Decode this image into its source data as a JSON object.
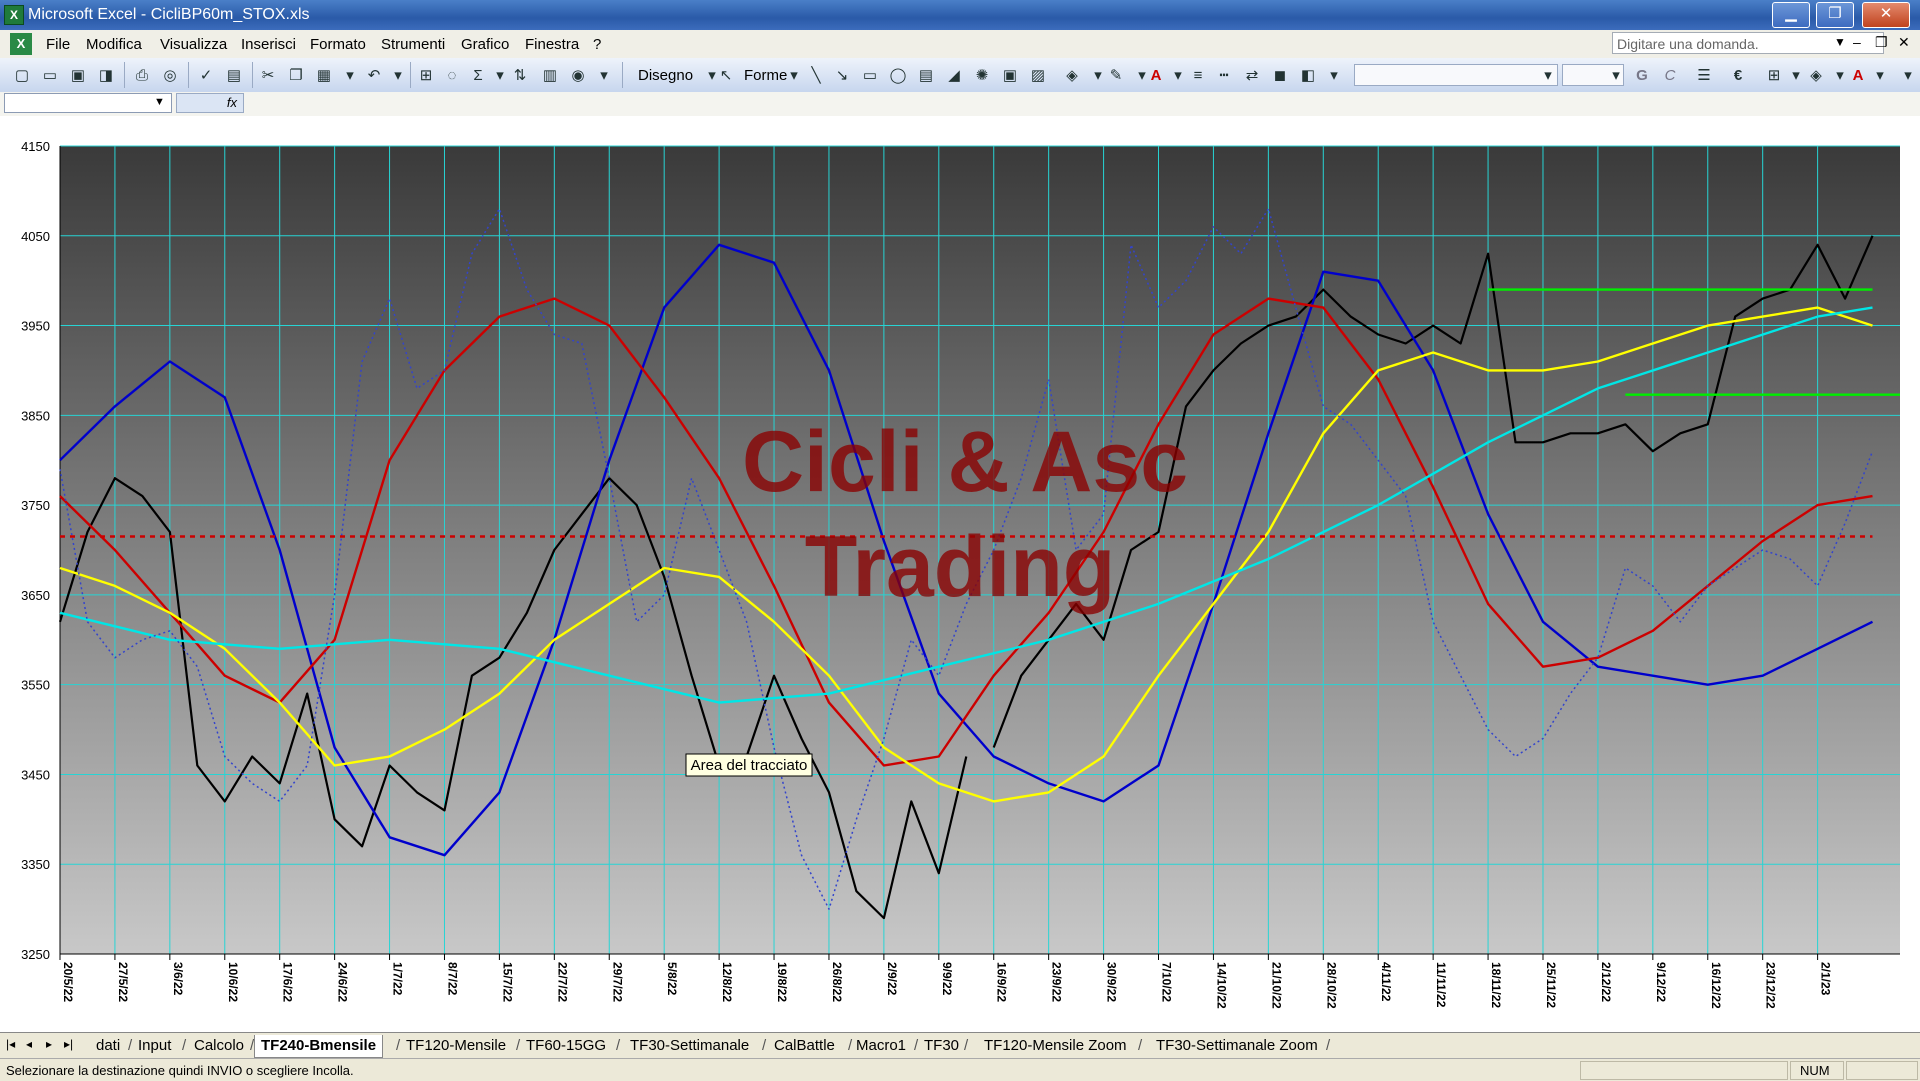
{
  "window": {
    "title": "Microsoft Excel - CicliBP60m_STOX.xls",
    "minimize": "▁",
    "restore": "❐",
    "close": "✕"
  },
  "menu": {
    "items": [
      "File",
      "Modifica",
      "Visualizza",
      "Inserisci",
      "Formato",
      "Strumenti",
      "Grafico",
      "Finestra",
      "?"
    ],
    "help_placeholder": "Digitare una domanda.",
    "doc_minimize": "‒",
    "doc_restore": "❐",
    "doc_close": "✕"
  },
  "toolbar": {
    "draw_label": "Disegno",
    "shapes_label": "Forme",
    "bold": "G",
    "italic": "C",
    "euro": "€"
  },
  "formula_bar": {
    "fx": "fx"
  },
  "chart_data": {
    "type": "line",
    "x_tick_labels": [
      "20/5/22",
      "27/5/22",
      "3/6/22",
      "10/6/22",
      "17/6/22",
      "24/6/22",
      "1/7/22",
      "8/7/22",
      "15/7/22",
      "22/7/22",
      "29/7/22",
      "5/8/22",
      "12/8/22",
      "19/8/22",
      "26/8/22",
      "2/9/22",
      "9/9/22",
      "16/9/22",
      "23/9/22",
      "30/9/22",
      "7/10/22",
      "14/10/22",
      "21/10/22",
      "28/10/22",
      "4/11/22",
      "11/11/22",
      "18/11/22",
      "25/11/22",
      "2/12/22",
      "9/12/22",
      "16/12/22",
      "23/12/22",
      "2/1/23"
    ],
    "y_ticks": [
      3250,
      3350,
      3450,
      3550,
      3650,
      3750,
      3850,
      3950,
      4050,
      4150
    ],
    "ylim": [
      3250,
      4150
    ],
    "grid": true,
    "legend": "none",
    "watermark": [
      "Cicli & Asc",
      "Trading"
    ],
    "tooltip": "Area del tracciato",
    "background": {
      "top": "#3a3a3a",
      "bottom": "#c8c8c8"
    },
    "series": [
      {
        "color": "#000000",
        "style": "solid",
        "x": [
          0,
          1,
          2,
          3,
          4,
          5,
          6,
          7,
          8,
          9,
          10,
          11,
          12,
          13,
          14,
          15,
          16,
          17,
          18,
          19,
          20,
          21,
          22,
          23,
          24,
          25,
          26,
          27,
          28,
          29,
          30,
          31,
          32,
          33
        ],
        "values": [
          3620,
          3720,
          3780,
          3760,
          3720,
          3460,
          3420,
          3470,
          3440,
          3540,
          3400,
          3370,
          3460,
          3430,
          3410,
          3560,
          3580,
          3630,
          3700,
          3740,
          3780,
          3750,
          3670,
          3560,
          3460,
          3470,
          3560,
          3490,
          3430,
          3320,
          3290,
          3420,
          3340,
          3470
        ]
      },
      {
        "color": "#000000",
        "style": "solid",
        "x": [
          34,
          35,
          36,
          37,
          38,
          39,
          40,
          41,
          42,
          43,
          44,
          45,
          46,
          47,
          48,
          49,
          50,
          51,
          52,
          53,
          54,
          55,
          56,
          57,
          58,
          59,
          60,
          61,
          62,
          63,
          64,
          65,
          66
        ],
        "values": [
          3480,
          3560,
          3600,
          3640,
          3600,
          3700,
          3720,
          3860,
          3900,
          3930,
          3950,
          3960,
          3990,
          3960,
          3940,
          3930,
          3950,
          3930,
          4030,
          3820,
          3820,
          3830,
          3830,
          3840,
          3810,
          3830,
          3840,
          3960,
          3980,
          3990,
          4040,
          3980,
          4050
        ]
      },
      {
        "color": "#0000cc",
        "style": "solid",
        "x": [
          0,
          2,
          4,
          6,
          8,
          10,
          12,
          14,
          16,
          18,
          20,
          22,
          24,
          26,
          28,
          30,
          32,
          34,
          36,
          38,
          40,
          42,
          44,
          46,
          48,
          50,
          52,
          54,
          56,
          58,
          60,
          62,
          64,
          66
        ],
        "values": [
          3800,
          3860,
          3910,
          3870,
          3700,
          3480,
          3380,
          3360,
          3430,
          3600,
          3800,
          3970,
          4040,
          4020,
          3900,
          3710,
          3540,
          3470,
          3440,
          3420,
          3460,
          3640,
          3830,
          4010,
          4000,
          3900,
          3740,
          3620,
          3570,
          3560,
          3550,
          3560,
          3590,
          3620
        ]
      },
      {
        "color": "#cc0000",
        "style": "solid",
        "x": [
          0,
          2,
          4,
          6,
          8,
          10,
          12,
          14,
          16,
          18,
          20,
          22,
          24,
          26,
          28,
          30,
          32,
          34,
          36,
          38,
          40,
          42,
          44,
          46,
          48,
          50,
          52,
          54,
          56,
          58,
          60,
          62,
          64,
          66
        ],
        "values": [
          3760,
          3700,
          3630,
          3560,
          3530,
          3600,
          3800,
          3900,
          3960,
          3980,
          3950,
          3870,
          3780,
          3660,
          3530,
          3460,
          3470,
          3560,
          3630,
          3720,
          3840,
          3940,
          3980,
          3970,
          3890,
          3770,
          3640,
          3570,
          3580,
          3610,
          3660,
          3710,
          3750,
          3760
        ]
      },
      {
        "color": "#ffff00",
        "style": "solid",
        "x": [
          0,
          2,
          4,
          6,
          8,
          10,
          12,
          14,
          16,
          18,
          20,
          22,
          24,
          26,
          28,
          30,
          32,
          34,
          36,
          38,
          40,
          42,
          44,
          46,
          48,
          50,
          52,
          54,
          56,
          58,
          60,
          62,
          64,
          66
        ],
        "values": [
          3680,
          3660,
          3630,
          3590,
          3530,
          3460,
          3470,
          3500,
          3540,
          3600,
          3640,
          3680,
          3670,
          3620,
          3560,
          3480,
          3440,
          3420,
          3430,
          3470,
          3560,
          3640,
          3720,
          3830,
          3900,
          3920,
          3900,
          3900,
          3910,
          3930,
          3950,
          3960,
          3970,
          3950
        ]
      },
      {
        "color": "#00e6e6",
        "style": "solid",
        "x": [
          0,
          4,
          8,
          12,
          16,
          20,
          24,
          28,
          32,
          36,
          40,
          44,
          48,
          52,
          56,
          60,
          64,
          66
        ],
        "values": [
          3630,
          3600,
          3590,
          3600,
          3590,
          3560,
          3530,
          3540,
          3570,
          3600,
          3640,
          3690,
          3750,
          3820,
          3880,
          3920,
          3960,
          3970
        ]
      },
      {
        "color": "#3344cc",
        "style": "dotted",
        "x": [
          0,
          1,
          2,
          3,
          4,
          5,
          6,
          7,
          8,
          9,
          10,
          11,
          12,
          13,
          14,
          15,
          16,
          17,
          18,
          19,
          20,
          21,
          22,
          23,
          24,
          25,
          26,
          27,
          28,
          29,
          30,
          31,
          32,
          33,
          34,
          35,
          36,
          37,
          38,
          39,
          40,
          41,
          42,
          43,
          44,
          45,
          46,
          47,
          48,
          49,
          50,
          51,
          52,
          53,
          54,
          55,
          56,
          57,
          58,
          59,
          60,
          61,
          62,
          63,
          64,
          65,
          66
        ],
        "values": [
          3790,
          3620,
          3580,
          3600,
          3610,
          3570,
          3470,
          3440,
          3420,
          3460,
          3650,
          3910,
          3980,
          3880,
          3900,
          4030,
          4080,
          3990,
          3940,
          3930,
          3780,
          3620,
          3650,
          3780,
          3700,
          3620,
          3480,
          3360,
          3300,
          3400,
          3490,
          3600,
          3560,
          3640,
          3700,
          3780,
          3890,
          3700,
          3740,
          4040,
          3970,
          4000,
          4060,
          4030,
          4080,
          3970,
          3860,
          3840,
          3800,
          3760,
          3620,
          3560,
          3500,
          3470,
          3490,
          3540,
          3580,
          3680,
          3660,
          3620,
          3660,
          3680,
          3700,
          3690,
          3660,
          3730,
          3810
        ]
      },
      {
        "color": "#cc0000",
        "style": "dashed",
        "x": [
          0,
          66
        ],
        "values": [
          3715,
          3715
        ]
      },
      {
        "color": "#00ee00",
        "style": "solid",
        "x": [
          52,
          66
        ],
        "values": [
          3990,
          3990
        ]
      },
      {
        "color": "#00ee00",
        "style": "solid",
        "x": [
          57,
          67
        ],
        "values": [
          3873,
          3873
        ]
      }
    ]
  },
  "sheets": {
    "nav": [
      "|◂",
      "◂",
      "▸",
      "▸|"
    ],
    "tabs": [
      "dati",
      "Input",
      "Calcolo",
      "TF240-Bmensile",
      "TF120-Mensile",
      "TF60-15GG",
      "TF30-Settimanale",
      "CalBattle",
      "Macro1",
      "TF30",
      "TF120-Mensile Zoom",
      "TF30-Settimanale Zoom"
    ],
    "active": "TF240-Bmensile"
  },
  "status": {
    "message": "Selezionare la destinazione quindi INVIO o scegliere Incolla.",
    "num": "NUM"
  }
}
